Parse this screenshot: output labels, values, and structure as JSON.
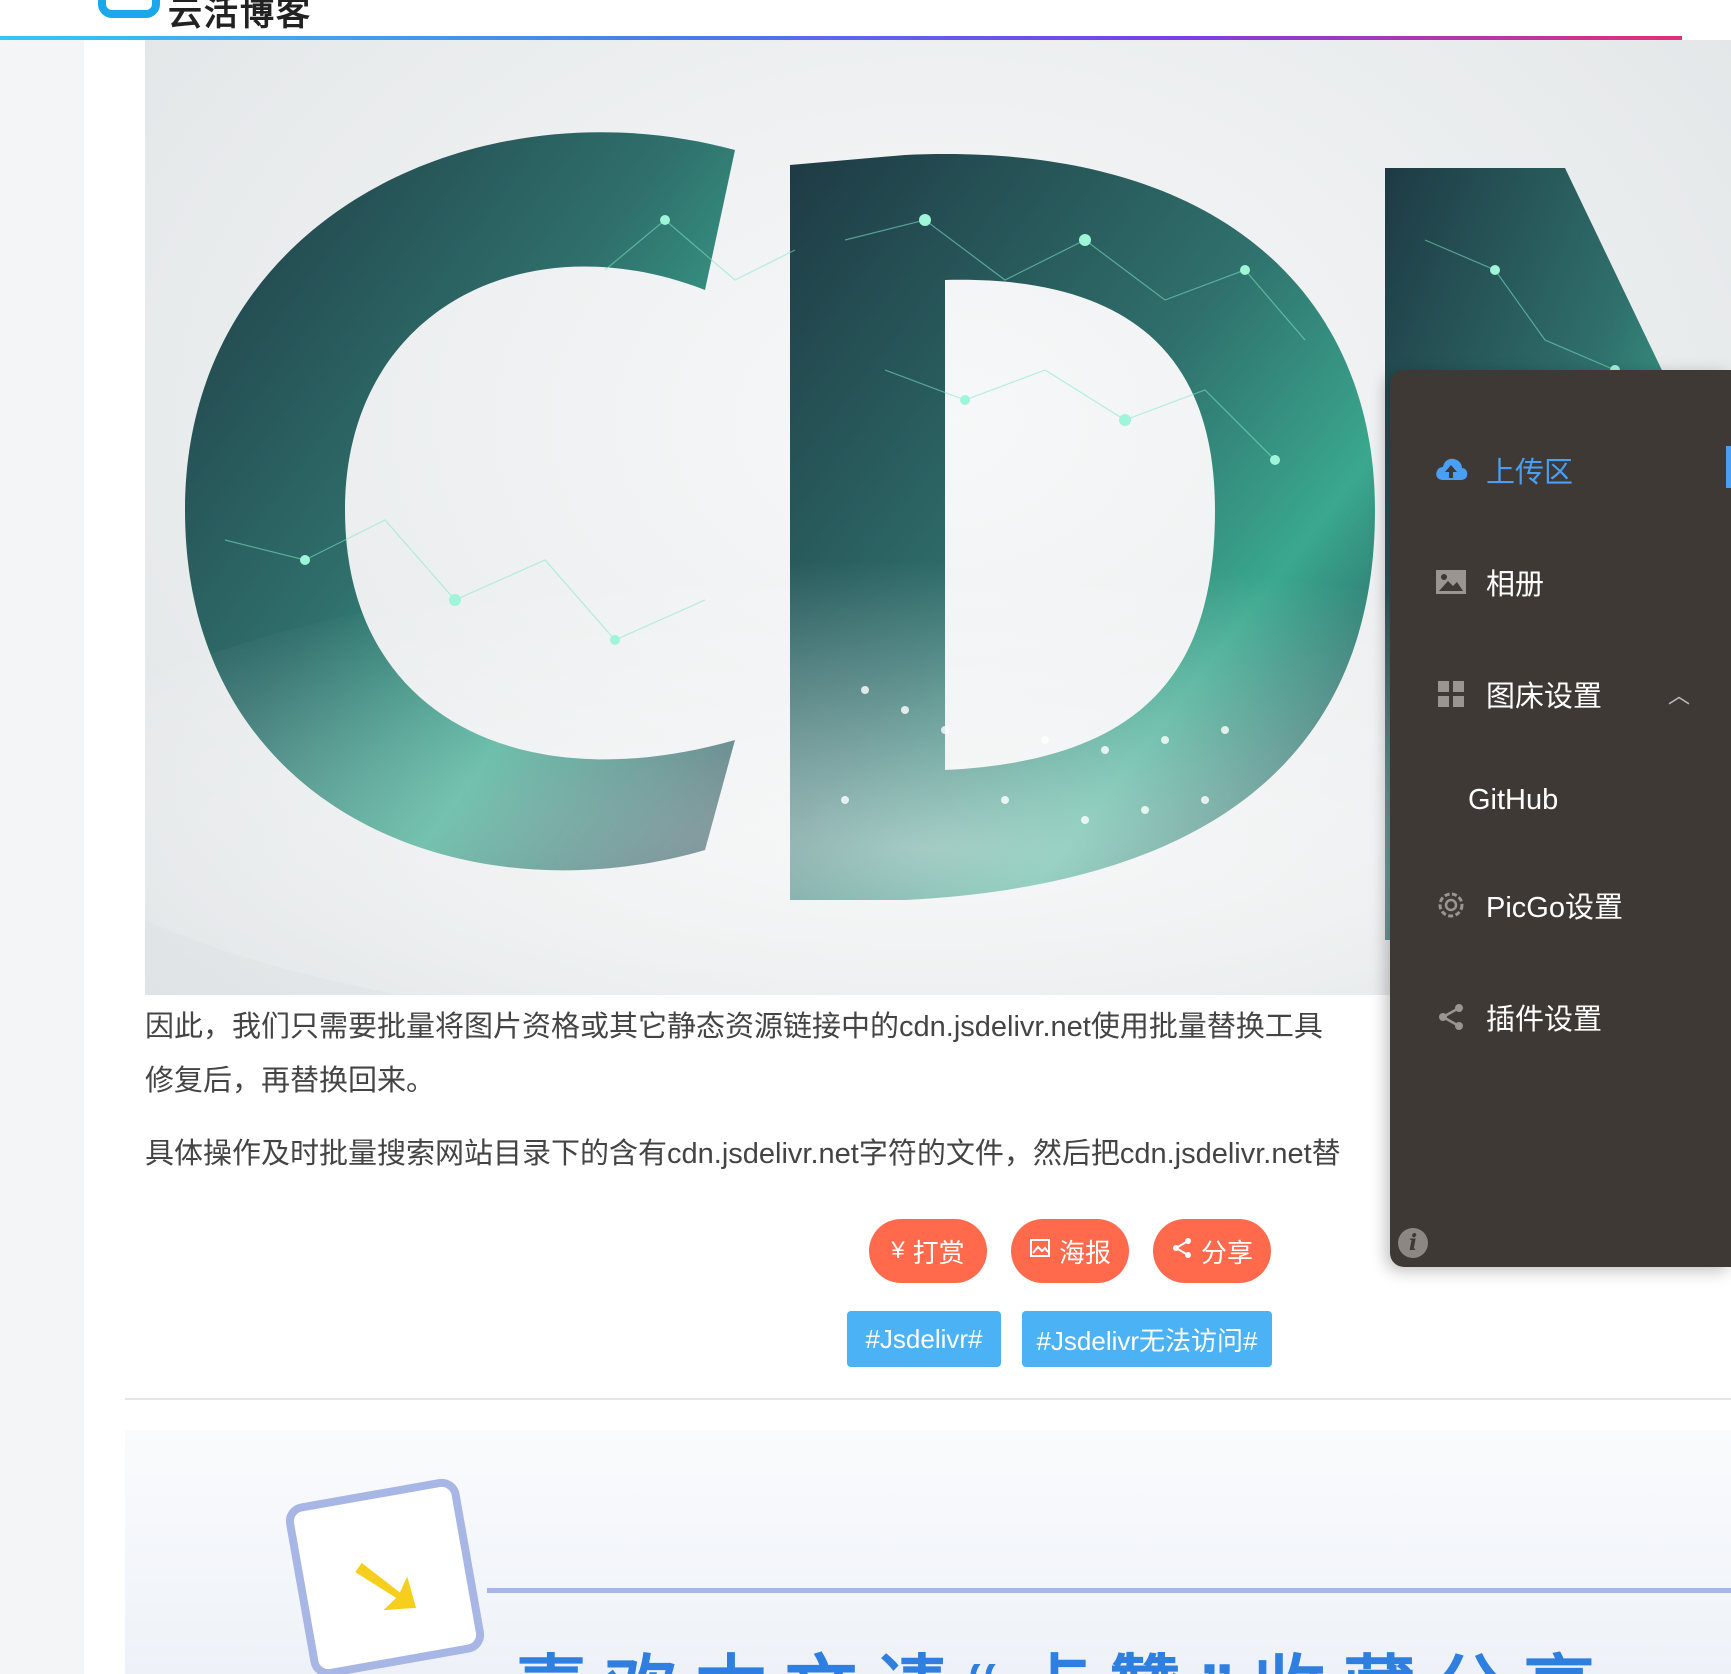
{
  "header": {
    "brand": "云活博客"
  },
  "article": {
    "hero_alt_letters": "CDN",
    "paragraph1_line1": "因此，我们只需要批量将图片资格或其它静态资源链接中的cdn.jsdelivr.net使用批量替换工具",
    "paragraph1_line2": "修复后，再替换回来。",
    "paragraph2": "具体操作及时批量搜索网站目录下的含有cdn.jsdelivr.net字符的文件，然后把cdn.jsdelivr.net替",
    "actions": {
      "reward": "打赏",
      "poster": "海报",
      "share": "分享",
      "reward_icon": "¥"
    },
    "tags": [
      "#Jsdelivr#",
      "#Jsdelivr无法访问#"
    ]
  },
  "promo": {
    "text": "喜欢本文请“点赞”收藏分享"
  },
  "picgo_menu": {
    "items": [
      {
        "label": "上传区",
        "icon": "cloud-upload-icon",
        "active": true
      },
      {
        "label": "相册",
        "icon": "image-icon"
      },
      {
        "label": "图床设置",
        "icon": "grid-icon",
        "expanded": true
      },
      {
        "label": "GitHub",
        "sub": true
      },
      {
        "label": "PicGo设置",
        "icon": "gear-icon"
      },
      {
        "label": "插件设置",
        "icon": "share-icon"
      }
    ],
    "info_icon": "i"
  },
  "colors": {
    "accent": "#4a9ff5",
    "action_pill": "#ff6a4d",
    "tag": "#4ab2f5",
    "menu_bg": "#3f3935"
  }
}
